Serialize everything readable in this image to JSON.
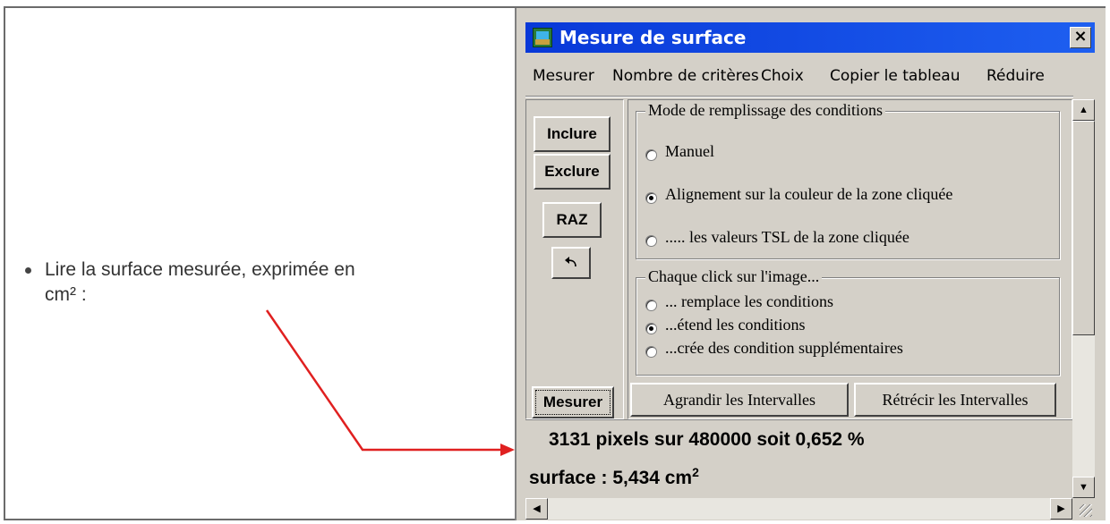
{
  "bullet": {
    "text_line1": "Lire la surface mesurée, exprimée en",
    "text_line2": "cm² :"
  },
  "window": {
    "title": "Mesure de surface",
    "close_label": "×"
  },
  "menu": [
    "Mesurer",
    "Nombre de critères",
    "Choix",
    "Copier le tableau",
    "Réduire"
  ],
  "left_buttons": {
    "inclure": "Inclure",
    "exclure": "Exclure",
    "raz": "RAZ",
    "undo_icon": "undo-arrow-icon",
    "mesurer": "Mesurer"
  },
  "mode_group": {
    "label": "Mode de remplissage des conditions",
    "options": [
      {
        "label": "Manuel",
        "selected": false
      },
      {
        "label": "Alignement sur la couleur de la zone cliquée",
        "selected": true
      },
      {
        "label": "..... les valeurs TSL de la zone cliquée",
        "selected": false
      }
    ]
  },
  "click_group": {
    "label": "Chaque click sur l'image...",
    "options": [
      {
        "label": "... remplace les conditions",
        "selected": false
      },
      {
        "label": "...étend les conditions",
        "selected": true
      },
      {
        "label": "...crée des condition supplémentaires",
        "selected": false
      }
    ]
  },
  "bottom_buttons": {
    "agrandir": "Agrandir les Intervalles",
    "retrecir": "Rétrécir les Intervalles"
  },
  "status": {
    "line1": "3131 pixels sur 480000 soit 0,652 %",
    "line2_prefix": "surface : 5,434 cm",
    "line2_sup": "2"
  },
  "colors": {
    "titlebar": "#0a3cdc",
    "window_bg": "#d4d0c8",
    "arrow": "#e02020"
  }
}
